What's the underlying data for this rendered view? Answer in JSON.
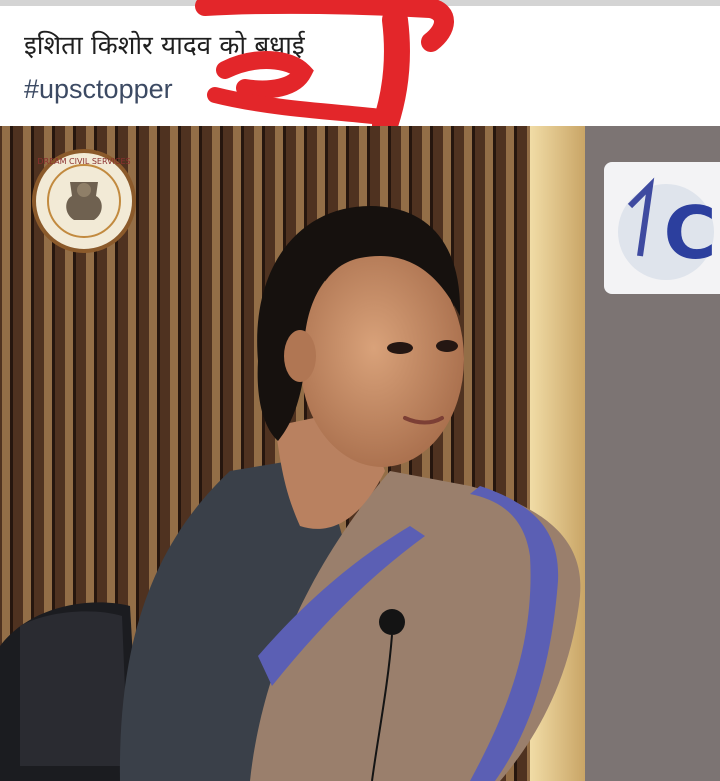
{
  "post": {
    "caption": "इशिता किशोर यादव को बधाई",
    "hashtag": "#upsctopper"
  },
  "photo": {
    "logo_text": "DREAM CIVIL SERVICES",
    "wall_badge_text": "C"
  },
  "colors": {
    "scribble": "#e3262a",
    "hashtag": "#3c4a63",
    "saree": "#9a7f6c",
    "saree_border": "#5b5fb4",
    "blouse": "#3a4049",
    "wall_panel": "#5b3a25",
    "wall_slat": "#a87e51"
  }
}
